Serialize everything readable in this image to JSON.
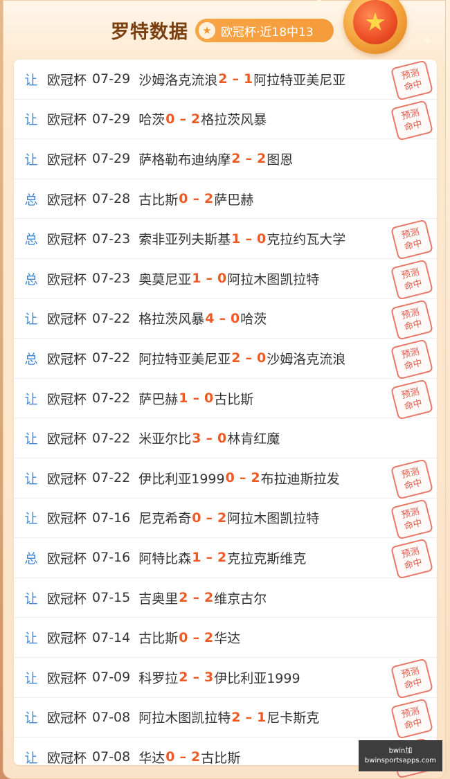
{
  "header": {
    "title": "罗特数据",
    "badge": "欧冠杯·近18中13",
    "badge_icon": "star-icon",
    "medal_icon": "star-medal-icon"
  },
  "stamp_text": [
    "预测",
    "命中"
  ],
  "colors": {
    "tag": "#3f86d8",
    "score": "#ee5a23",
    "badge": "#f59b3b",
    "stamp": "#e05848"
  },
  "matches": [
    {
      "tag": "让",
      "league": "欧冠杯",
      "date": "07-29",
      "home": "沙姆洛克流浪",
      "home_score": "2",
      "dash": "–",
      "away_score": "1",
      "away": "阿拉特亚美尼亚",
      "hit": true
    },
    {
      "tag": "让",
      "league": "欧冠杯",
      "date": "07-29",
      "home": "哈茨",
      "home_score": "0",
      "dash": "–",
      "away_score": "2",
      "away": "格拉茨风暴",
      "hit": true
    },
    {
      "tag": "让",
      "league": "欧冠杯",
      "date": "07-29",
      "home": "萨格勒布迪纳摩",
      "home_score": "2",
      "dash": "–",
      "away_score": "2",
      "away": "图恩",
      "hit": false
    },
    {
      "tag": "总",
      "league": "欧冠杯",
      "date": "07-28",
      "home": "古比斯",
      "home_score": "0",
      "dash": "–",
      "away_score": "2",
      "away": "萨巴赫",
      "hit": false
    },
    {
      "tag": "总",
      "league": "欧冠杯",
      "date": "07-23",
      "home": "索非亚列夫斯基",
      "home_score": "1",
      "dash": "–",
      "away_score": "0",
      "away": "克拉约瓦大学",
      "hit": true
    },
    {
      "tag": "总",
      "league": "欧冠杯",
      "date": "07-23",
      "home": "奥莫尼亚",
      "home_score": "1",
      "dash": "–",
      "away_score": "0",
      "away": "阿拉木图凯拉特",
      "hit": true
    },
    {
      "tag": "让",
      "league": "欧冠杯",
      "date": "07-22",
      "home": "格拉茨风暴",
      "home_score": "4",
      "dash": "–",
      "away_score": "0",
      "away": "哈茨",
      "hit": true
    },
    {
      "tag": "总",
      "league": "欧冠杯",
      "date": "07-22",
      "home": "阿拉特亚美尼亚",
      "home_score": "2",
      "dash": "–",
      "away_score": "0",
      "away": "沙姆洛克流浪",
      "hit": true
    },
    {
      "tag": "让",
      "league": "欧冠杯",
      "date": "07-22",
      "home": "萨巴赫",
      "home_score": "1",
      "dash": "–",
      "away_score": "0",
      "away": "古比斯",
      "hit": true
    },
    {
      "tag": "让",
      "league": "欧冠杯",
      "date": "07-22",
      "home": "米亚尔比",
      "home_score": "3",
      "dash": "–",
      "away_score": "0",
      "away": "林肯红魔",
      "hit": false
    },
    {
      "tag": "让",
      "league": "欧冠杯",
      "date": "07-22",
      "home": "伊比利亚1999",
      "home_score": "0",
      "dash": "–",
      "away_score": "2",
      "away": "布拉迪斯拉发",
      "hit": true
    },
    {
      "tag": "让",
      "league": "欧冠杯",
      "date": "07-16",
      "home": "尼克希奇",
      "home_score": "0",
      "dash": "–",
      "away_score": "2",
      "away": "阿拉木图凯拉特",
      "hit": true
    },
    {
      "tag": "总",
      "league": "欧冠杯",
      "date": "07-16",
      "home": "阿特比森",
      "home_score": "1",
      "dash": "–",
      "away_score": "2",
      "away": "克拉克斯维克",
      "hit": true
    },
    {
      "tag": "让",
      "league": "欧冠杯",
      "date": "07-15",
      "home": "吉奥里",
      "home_score": "2",
      "dash": "–",
      "away_score": "2",
      "away": "维京古尔",
      "hit": false
    },
    {
      "tag": "让",
      "league": "欧冠杯",
      "date": "07-14",
      "home": "古比斯",
      "home_score": "0",
      "dash": "–",
      "away_score": "2",
      "away": "华达",
      "hit": false
    },
    {
      "tag": "让",
      "league": "欧冠杯",
      "date": "07-09",
      "home": "科罗拉",
      "home_score": "2",
      "dash": "–",
      "away_score": "3",
      "away": "伊比利亚1999",
      "hit": true
    },
    {
      "tag": "让",
      "league": "欧冠杯",
      "date": "07-08",
      "home": "阿拉木图凯拉特",
      "home_score": "2",
      "dash": "–",
      "away_score": "1",
      "away": "尼卡斯克",
      "hit": true
    },
    {
      "tag": "让",
      "league": "欧冠杯",
      "date": "07-08",
      "home": "华达",
      "home_score": "0",
      "dash": "–",
      "away_score": "2",
      "away": "古比斯",
      "hit": true
    }
  ],
  "watermark": {
    "line1": "bwin加",
    "line2": "bwinsportsapps.com"
  }
}
